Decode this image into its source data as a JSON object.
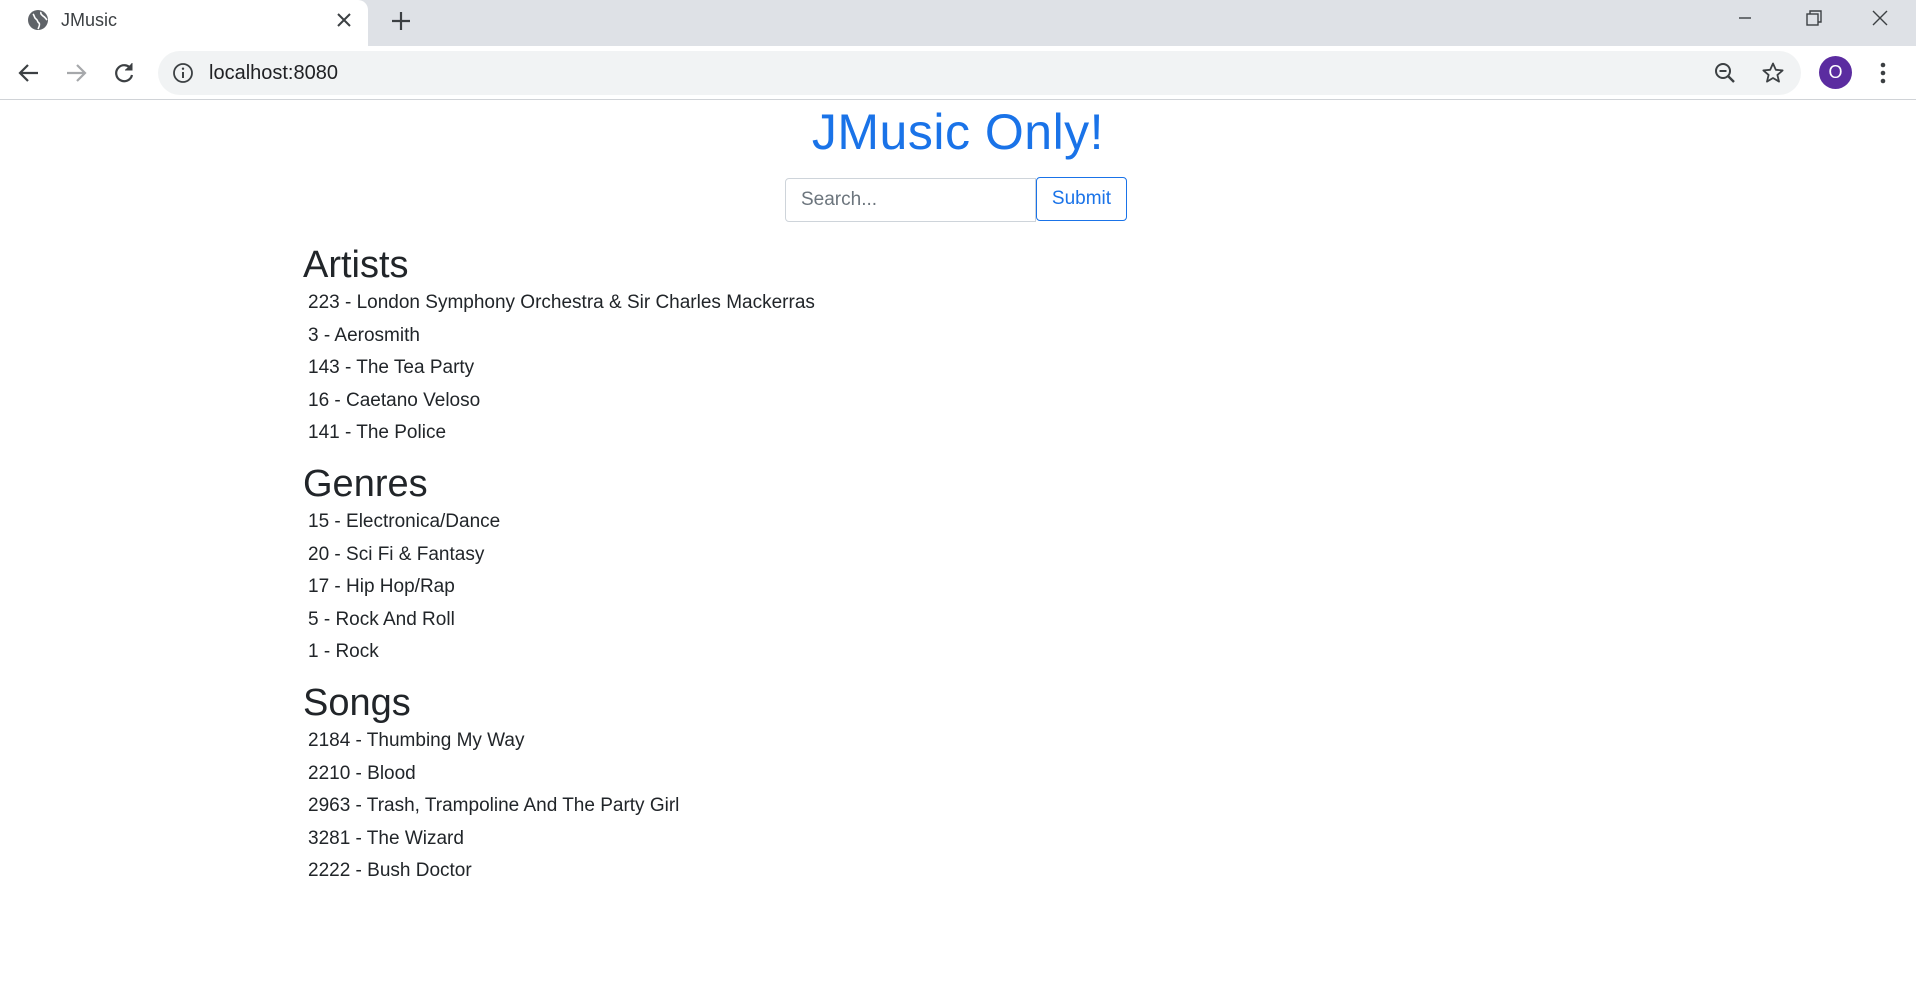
{
  "browser": {
    "tab": {
      "title": "JMusic",
      "favicon": "globe-icon"
    },
    "address_bar": {
      "url": "localhost:8080"
    },
    "profile_initial": "O",
    "icons": [
      "close-icon",
      "plus-icon",
      "minimize-icon",
      "restore-icon",
      "window-close-icon",
      "back-arrow-icon",
      "forward-arrow-icon",
      "reload-icon",
      "info-icon",
      "zoom-out-icon",
      "star-icon",
      "kebab-menu-icon"
    ]
  },
  "page": {
    "title": "JMusic Only!",
    "search": {
      "placeholder": "Search...",
      "value": "",
      "submit_label": "Submit"
    },
    "artists": {
      "heading": "Artists",
      "items": [
        "223 - London Symphony Orchestra & Sir Charles Mackerras",
        "3 - Aerosmith",
        "143 - The Tea Party",
        "16 - Caetano Veloso",
        "141 - The Police"
      ]
    },
    "genres": {
      "heading": "Genres",
      "items": [
        "15 - Electronica/Dance",
        "20 - Sci Fi & Fantasy",
        "17 - Hip Hop/Rap",
        "5 - Rock And Roll",
        "1 - Rock"
      ]
    },
    "songs": {
      "heading": "Songs",
      "items": [
        "2184 - Thumbing My Way",
        "2210 - Blood",
        "2963 - Trash, Trampoline And The Party Girl",
        "3281 - The Wizard",
        "2222 - Bush Doctor"
      ]
    }
  },
  "colors": {
    "accent": "#1a73e8",
    "text": "#212529",
    "tabstrip": "#dee1e6",
    "omnibox": "#f1f3f4",
    "avatar": "#5b2ca0"
  }
}
